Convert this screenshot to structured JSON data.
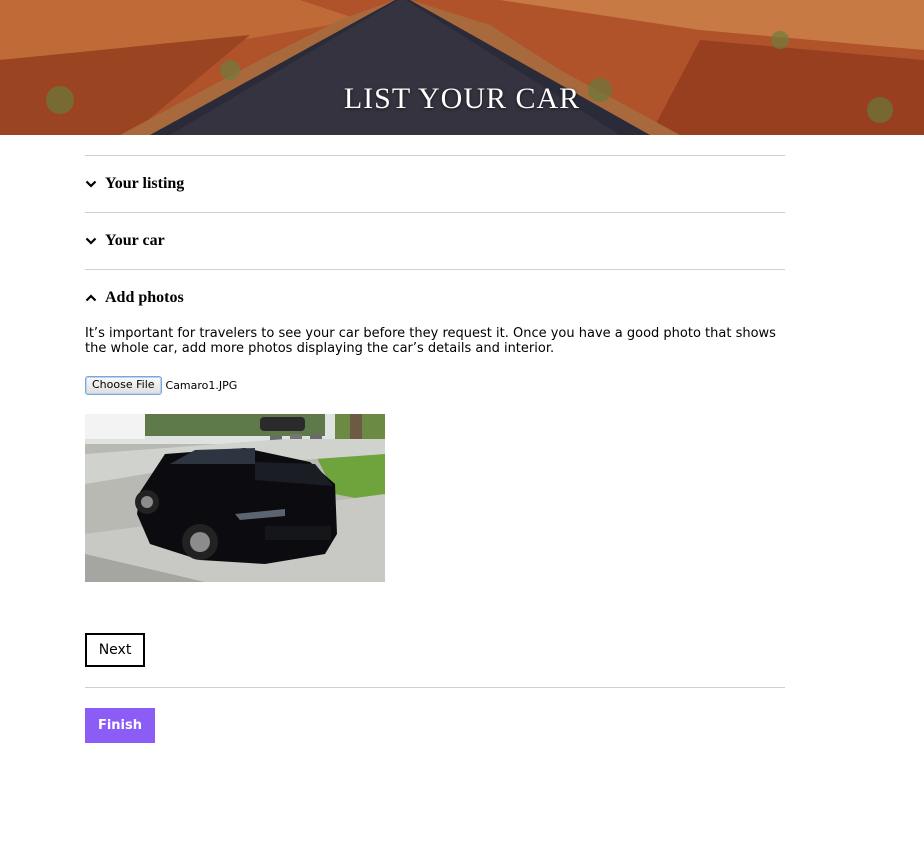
{
  "hero": {
    "title": "LIST YOUR CAR"
  },
  "sections": [
    {
      "label": "Your listing",
      "state": "collapsed",
      "icon": "chevron-down-icon"
    },
    {
      "label": "Your car",
      "state": "collapsed",
      "icon": "chevron-down-icon"
    },
    {
      "label": "Add photos",
      "state": "expanded",
      "icon": "chevron-up-icon"
    }
  ],
  "photos": {
    "description": "It’s important for travelers to see your car before they request it. Once you have a good photo that shows the whole car, add more photos displaying the car’s details and interior.",
    "choose_file_label": "Choose File",
    "file_name": "Camaro1.JPG"
  },
  "buttons": {
    "next_label": "Next",
    "finish_label": "Finish"
  },
  "colors": {
    "finish_bg": "#8b5cf6",
    "divider": "#cfcfcf"
  }
}
